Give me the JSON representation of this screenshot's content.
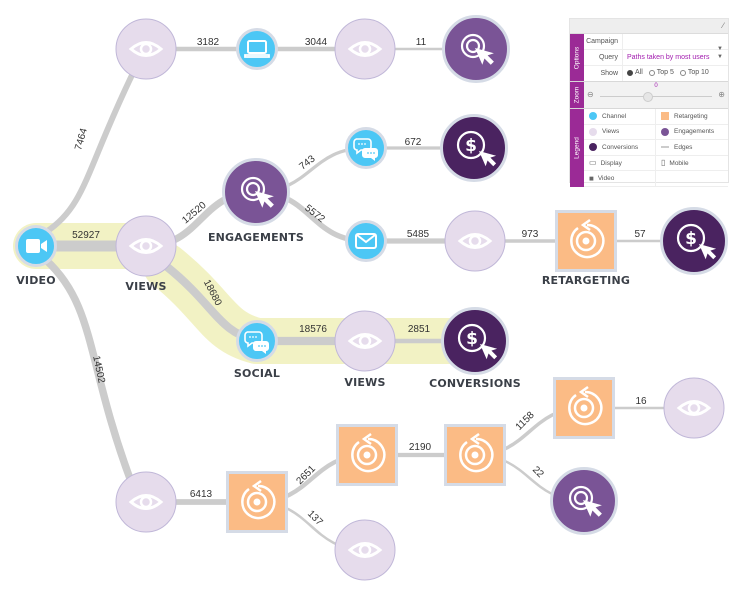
{
  "colors": {
    "channel": "#4cc7f5",
    "views": "#e6dcec",
    "views_stroke": "#c0b7d8",
    "engagements": "#7a5496",
    "conversions": "#4a2360",
    "retargeting": "#fbbb85",
    "edge": "#cccccc",
    "highlight": "#f2f2c4",
    "panel_accent": "#9b2a96",
    "query_text": "#a21caf"
  },
  "nodes": [
    {
      "id": "video",
      "type": "channel",
      "icon": "video-camera-icon",
      "label": "VIDEO"
    },
    {
      "id": "views-a",
      "type": "views",
      "icon": "eye-icon",
      "label": ""
    },
    {
      "id": "display-1",
      "type": "channel",
      "icon": "laptop-icon",
      "label": ""
    },
    {
      "id": "views-b",
      "type": "views",
      "icon": "eye-icon",
      "label": ""
    },
    {
      "id": "engagement-top",
      "type": "engagements",
      "icon": "click-target-icon",
      "label": ""
    },
    {
      "id": "views-main",
      "type": "views",
      "icon": "eye-icon",
      "label": "VIEWS"
    },
    {
      "id": "engagements-main",
      "type": "engagements",
      "icon": "click-target-icon",
      "label": "ENGAGEMENTS"
    },
    {
      "id": "social-1",
      "type": "channel",
      "icon": "chat-bubbles-icon",
      "label": ""
    },
    {
      "id": "conversion-1",
      "type": "conversions",
      "icon": "dollar-click-icon",
      "label": ""
    },
    {
      "id": "email-1",
      "type": "channel",
      "icon": "envelope-icon",
      "label": ""
    },
    {
      "id": "views-c",
      "type": "views",
      "icon": "eye-icon",
      "label": ""
    },
    {
      "id": "retargeting-1",
      "type": "retargeting",
      "icon": "retarget-icon",
      "label": "RETARGETING"
    },
    {
      "id": "conversion-2",
      "type": "conversions",
      "icon": "dollar-click-icon",
      "label": ""
    },
    {
      "id": "social-main",
      "type": "channel",
      "icon": "chat-bubbles-icon",
      "label": "SOCIAL"
    },
    {
      "id": "views-social",
      "type": "views",
      "icon": "eye-icon",
      "label": "VIEWS"
    },
    {
      "id": "conversions-main",
      "type": "conversions",
      "icon": "dollar-click-icon",
      "label": "CONVERSIONS"
    },
    {
      "id": "views-d",
      "type": "views",
      "icon": "eye-icon",
      "label": ""
    },
    {
      "id": "retargeting-2",
      "type": "retargeting",
      "icon": "retarget-icon",
      "label": ""
    },
    {
      "id": "retargeting-3",
      "type": "retargeting",
      "icon": "retarget-icon",
      "label": ""
    },
    {
      "id": "views-e",
      "type": "views",
      "icon": "eye-icon",
      "label": ""
    },
    {
      "id": "retargeting-4",
      "type": "retargeting",
      "icon": "retarget-icon",
      "label": ""
    },
    {
      "id": "retargeting-5",
      "type": "retargeting",
      "icon": "retarget-icon",
      "label": ""
    },
    {
      "id": "views-f",
      "type": "views",
      "icon": "eye-icon",
      "label": ""
    },
    {
      "id": "engagement-bottom",
      "type": "engagements",
      "icon": "click-target-icon",
      "label": ""
    }
  ],
  "edges": [
    {
      "from": "video",
      "to": "views-a",
      "value": 7464
    },
    {
      "from": "views-a",
      "to": "display-1",
      "value": 3182
    },
    {
      "from": "display-1",
      "to": "views-b",
      "value": 3044
    },
    {
      "from": "views-b",
      "to": "engagement-top",
      "value": 11
    },
    {
      "from": "video",
      "to": "views-main",
      "value": 52927,
      "highlighted": true
    },
    {
      "from": "views-main",
      "to": "engagements-main",
      "value": 12520
    },
    {
      "from": "engagements-main",
      "to": "social-1",
      "value": 743
    },
    {
      "from": "social-1",
      "to": "conversion-1",
      "value": 672
    },
    {
      "from": "engagements-main",
      "to": "email-1",
      "value": 5572
    },
    {
      "from": "email-1",
      "to": "views-c",
      "value": 5485
    },
    {
      "from": "views-c",
      "to": "retargeting-1",
      "value": 973
    },
    {
      "from": "retargeting-1",
      "to": "conversion-2",
      "value": 57
    },
    {
      "from": "views-main",
      "to": "social-main",
      "value": 18680,
      "highlighted": true
    },
    {
      "from": "social-main",
      "to": "views-social",
      "value": 18576,
      "highlighted": true
    },
    {
      "from": "views-social",
      "to": "conversions-main",
      "value": 2851,
      "highlighted": true
    },
    {
      "from": "video",
      "to": "views-d",
      "value": 14502
    },
    {
      "from": "views-d",
      "to": "retargeting-2",
      "value": 6413
    },
    {
      "from": "retargeting-2",
      "to": "retargeting-3",
      "value": 2651
    },
    {
      "from": "retargeting-2",
      "to": "views-e",
      "value": 137
    },
    {
      "from": "retargeting-3",
      "to": "retargeting-4",
      "value": 2190
    },
    {
      "from": "retargeting-4",
      "to": "retargeting-5",
      "value": 1158
    },
    {
      "from": "retargeting-5",
      "to": "views-f",
      "value": 16
    },
    {
      "from": "retargeting-4",
      "to": "engagement-bottom",
      "value": 22
    }
  ],
  "panel": {
    "sections": {
      "options": "Options",
      "zoom": "Zoom",
      "legend": "Legend"
    },
    "campaign": {
      "label": "Campaign",
      "value": ""
    },
    "query": {
      "label": "Query",
      "value": "Paths taken by most users"
    },
    "show": {
      "label": "Show",
      "options": [
        "All",
        "Top 5",
        "Top 10"
      ],
      "selected": "All"
    },
    "zoom": {
      "value": "0",
      "level": 0.5
    },
    "legend": [
      {
        "label": "Channel",
        "swatch": "channel"
      },
      {
        "label": "Retargeting",
        "swatch": "retargeting"
      },
      {
        "label": "Views",
        "swatch": "views"
      },
      {
        "label": "Engagements",
        "swatch": "engagements"
      },
      {
        "label": "Conversions",
        "swatch": "conversions"
      },
      {
        "label": "Edges",
        "swatch": "edge"
      },
      {
        "label": "Display",
        "swatch": "display-glyph"
      },
      {
        "label": "Mobile",
        "swatch": "mobile-glyph"
      },
      {
        "label": "Video",
        "swatch": "video-glyph"
      }
    ]
  }
}
